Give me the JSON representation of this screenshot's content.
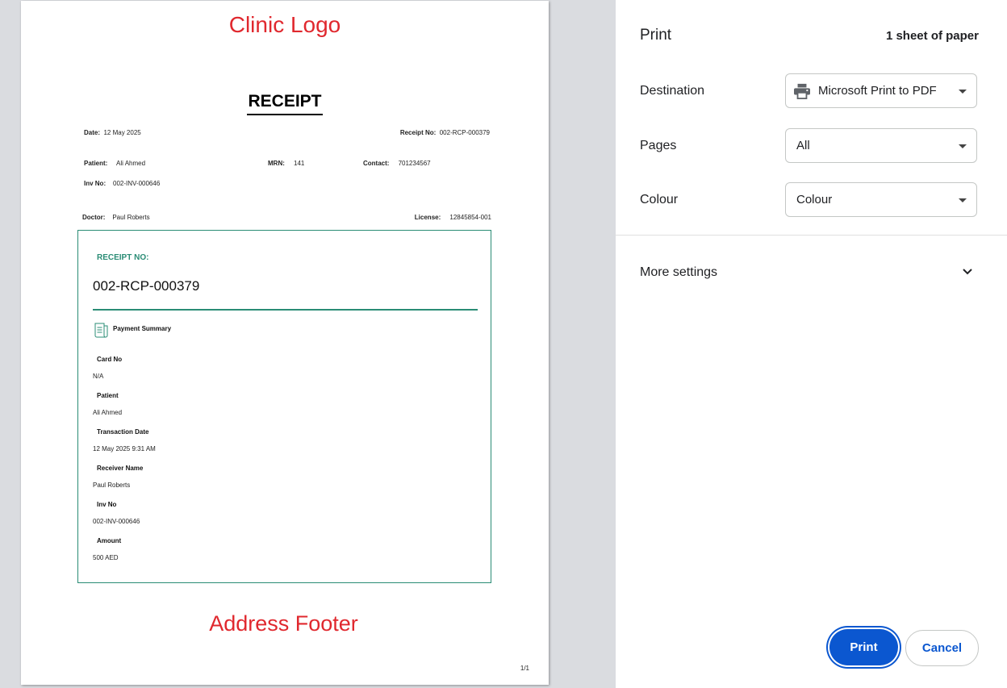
{
  "preview": {
    "logo_text": "Clinic Logo",
    "title": "RECEIPT",
    "date_label": "Date:",
    "date_value": "12 May 2025",
    "receipt_no_label": "Receipt No:",
    "receipt_no_value": "002-RCP-000379",
    "patient_label": "Patient:",
    "patient_value": "Ali Ahmed",
    "mrn_label": "MRN:",
    "mrn_value": "141",
    "contact_label": "Contact:",
    "contact_value": "701234567",
    "inv_label": "Inv No:",
    "inv_value": "002-INV-000646",
    "doctor_label": "Doctor:",
    "doctor_value": "Paul Roberts",
    "license_label": "License:",
    "license_value": "12845854-001",
    "box": {
      "label": "RECEIPT NO:",
      "number": "002-RCP-000379",
      "summary_title": "Payment Summary",
      "fields": [
        {
          "label": "Card No",
          "value": "N/A"
        },
        {
          "label": "Patient",
          "value": "Ali Ahmed"
        },
        {
          "label": "Transaction Date",
          "value": "12 May 2025 9:31 AM"
        },
        {
          "label": "Receiver Name",
          "value": "Paul Roberts"
        },
        {
          "label": "Inv No",
          "value": "002-INV-000646"
        },
        {
          "label": "Amount",
          "value": "500 AED"
        }
      ]
    },
    "footer_text": "Address Footer",
    "page_number": "1/1"
  },
  "panel": {
    "title": "Print",
    "sheets": "1 sheet of paper",
    "destination_label": "Destination",
    "destination_value": "Microsoft Print to PDF",
    "pages_label": "Pages",
    "pages_value": "All",
    "colour_label": "Colour",
    "colour_value": "Colour",
    "more_settings": "More settings",
    "print_button": "Print",
    "cancel_button": "Cancel"
  },
  "colors": {
    "accent": "#0b57d0",
    "receipt_teal": "#2a8c75",
    "placeholder_red": "#e0282e"
  },
  "icons": [
    "printer-icon",
    "chevron-down-icon",
    "receipt-icon",
    "caret-down-icon"
  ]
}
